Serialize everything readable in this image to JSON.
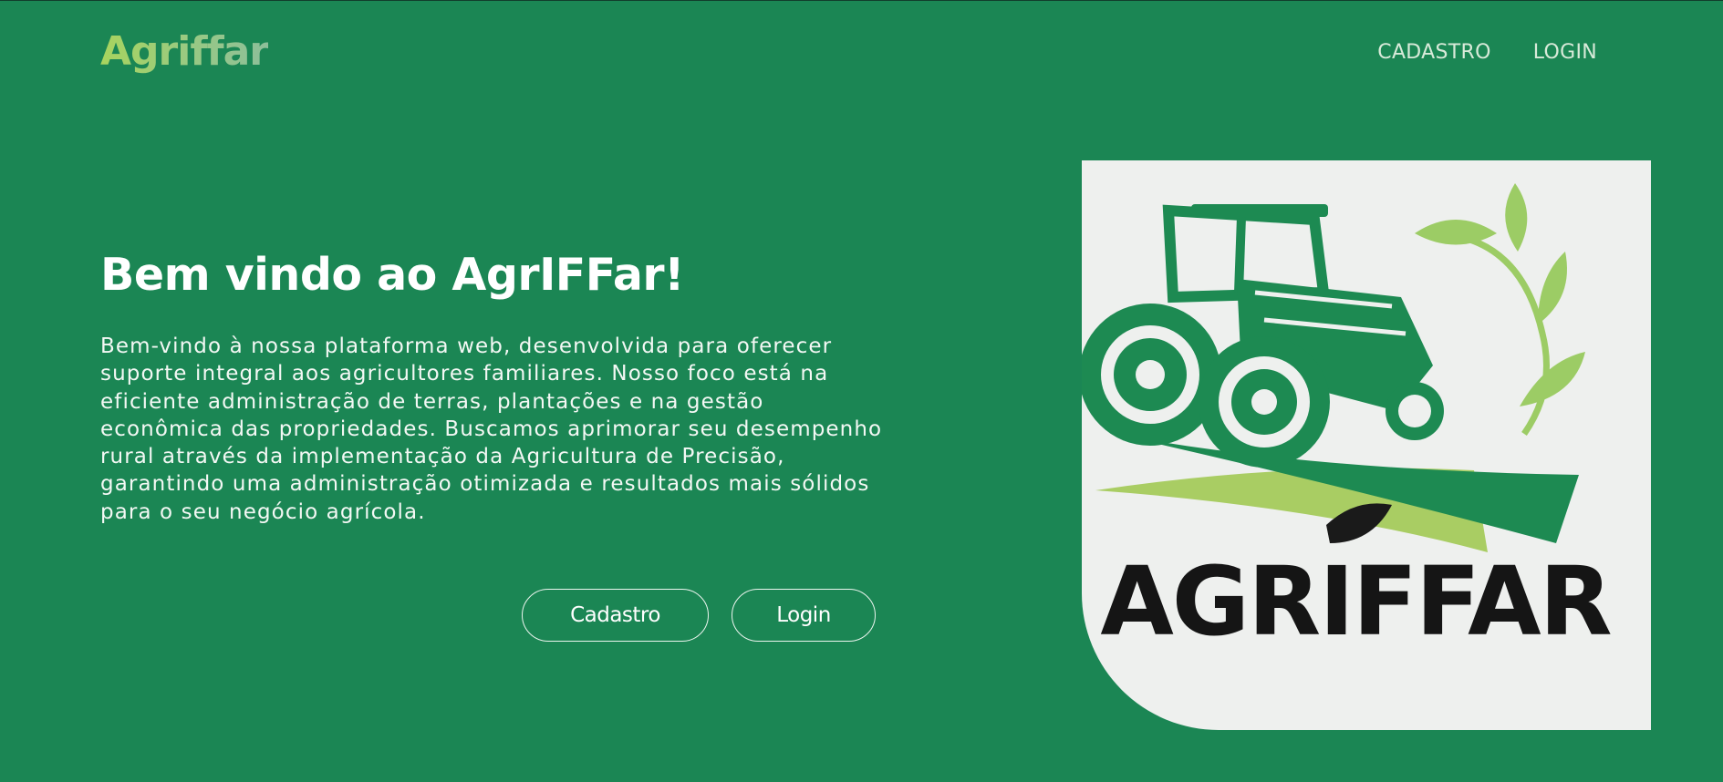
{
  "brand": {
    "name": "Agriffar",
    "primary_color": "#1b8654",
    "logo_gradient": [
      "#a8d45e",
      "#8dbf9a"
    ]
  },
  "nav": {
    "items": [
      {
        "label": "CADASTRO"
      },
      {
        "label": "LOGIN"
      }
    ]
  },
  "hero": {
    "title": "Bem vindo ao AgrIFFar!",
    "paragraph": "Bem-vindo à nossa plataforma web, desenvolvida para oferecer suporte integral aos agricultores familiares. Nosso foco está na eficiente administração de terras, plantações e na gestão econômica das propriedades. Buscamos aprimorar seu desempenho rural através da implementação da Agricultura de Precisão, garantindo uma administração otimizada e resultados mais sólidos para o seu negócio agrícola.",
    "buttons": {
      "cadastro": "Cadastro",
      "login": "Login"
    }
  },
  "image": {
    "wordmark": "AGRIFFAR",
    "icons": [
      "tractor-icon",
      "leaf-branch-icon",
      "leaf-icon"
    ]
  }
}
